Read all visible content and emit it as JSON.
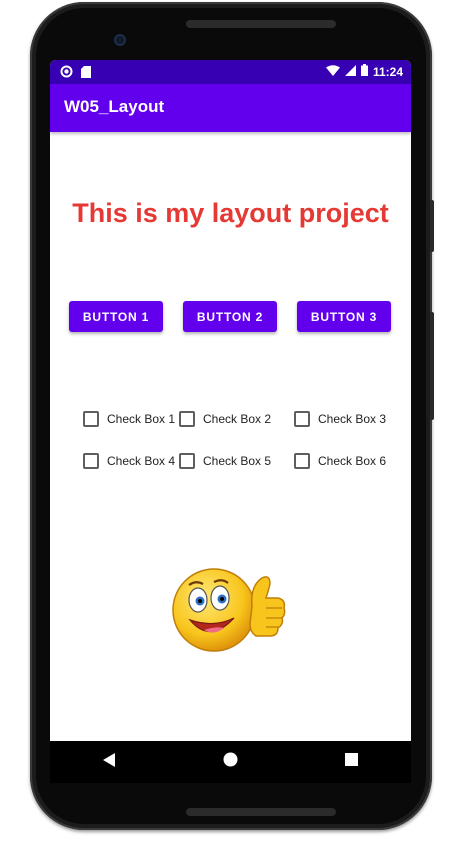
{
  "status_bar": {
    "time": "11:24",
    "icons_left": [
      "notification-circle-icon",
      "sd-card-icon"
    ],
    "icons_right": [
      "wifi-icon",
      "signal-icon",
      "battery-icon"
    ]
  },
  "app_bar": {
    "title": "W05_Layout"
  },
  "headline": "This is my layout project",
  "buttons": [
    "BUTTON 1",
    "BUTTON 2",
    "BUTTON 3"
  ],
  "checkboxes": [
    {
      "label": "Check Box 1",
      "checked": false
    },
    {
      "label": "Check Box 2",
      "checked": false
    },
    {
      "label": "Check Box 3",
      "checked": false
    },
    {
      "label": "Check Box 4",
      "checked": false
    },
    {
      "label": "Check Box 5",
      "checked": false
    },
    {
      "label": "Check Box 6",
      "checked": false
    }
  ],
  "image": {
    "icon": "thumbs-up-smiley-emoji"
  },
  "nav_bar": {
    "icons": [
      "back-icon",
      "home-icon",
      "recents-icon"
    ]
  },
  "colors": {
    "status_bar": "#3700b3",
    "app_bar": "#6200ee",
    "headline": "#e53935",
    "button": "#6200ee"
  }
}
